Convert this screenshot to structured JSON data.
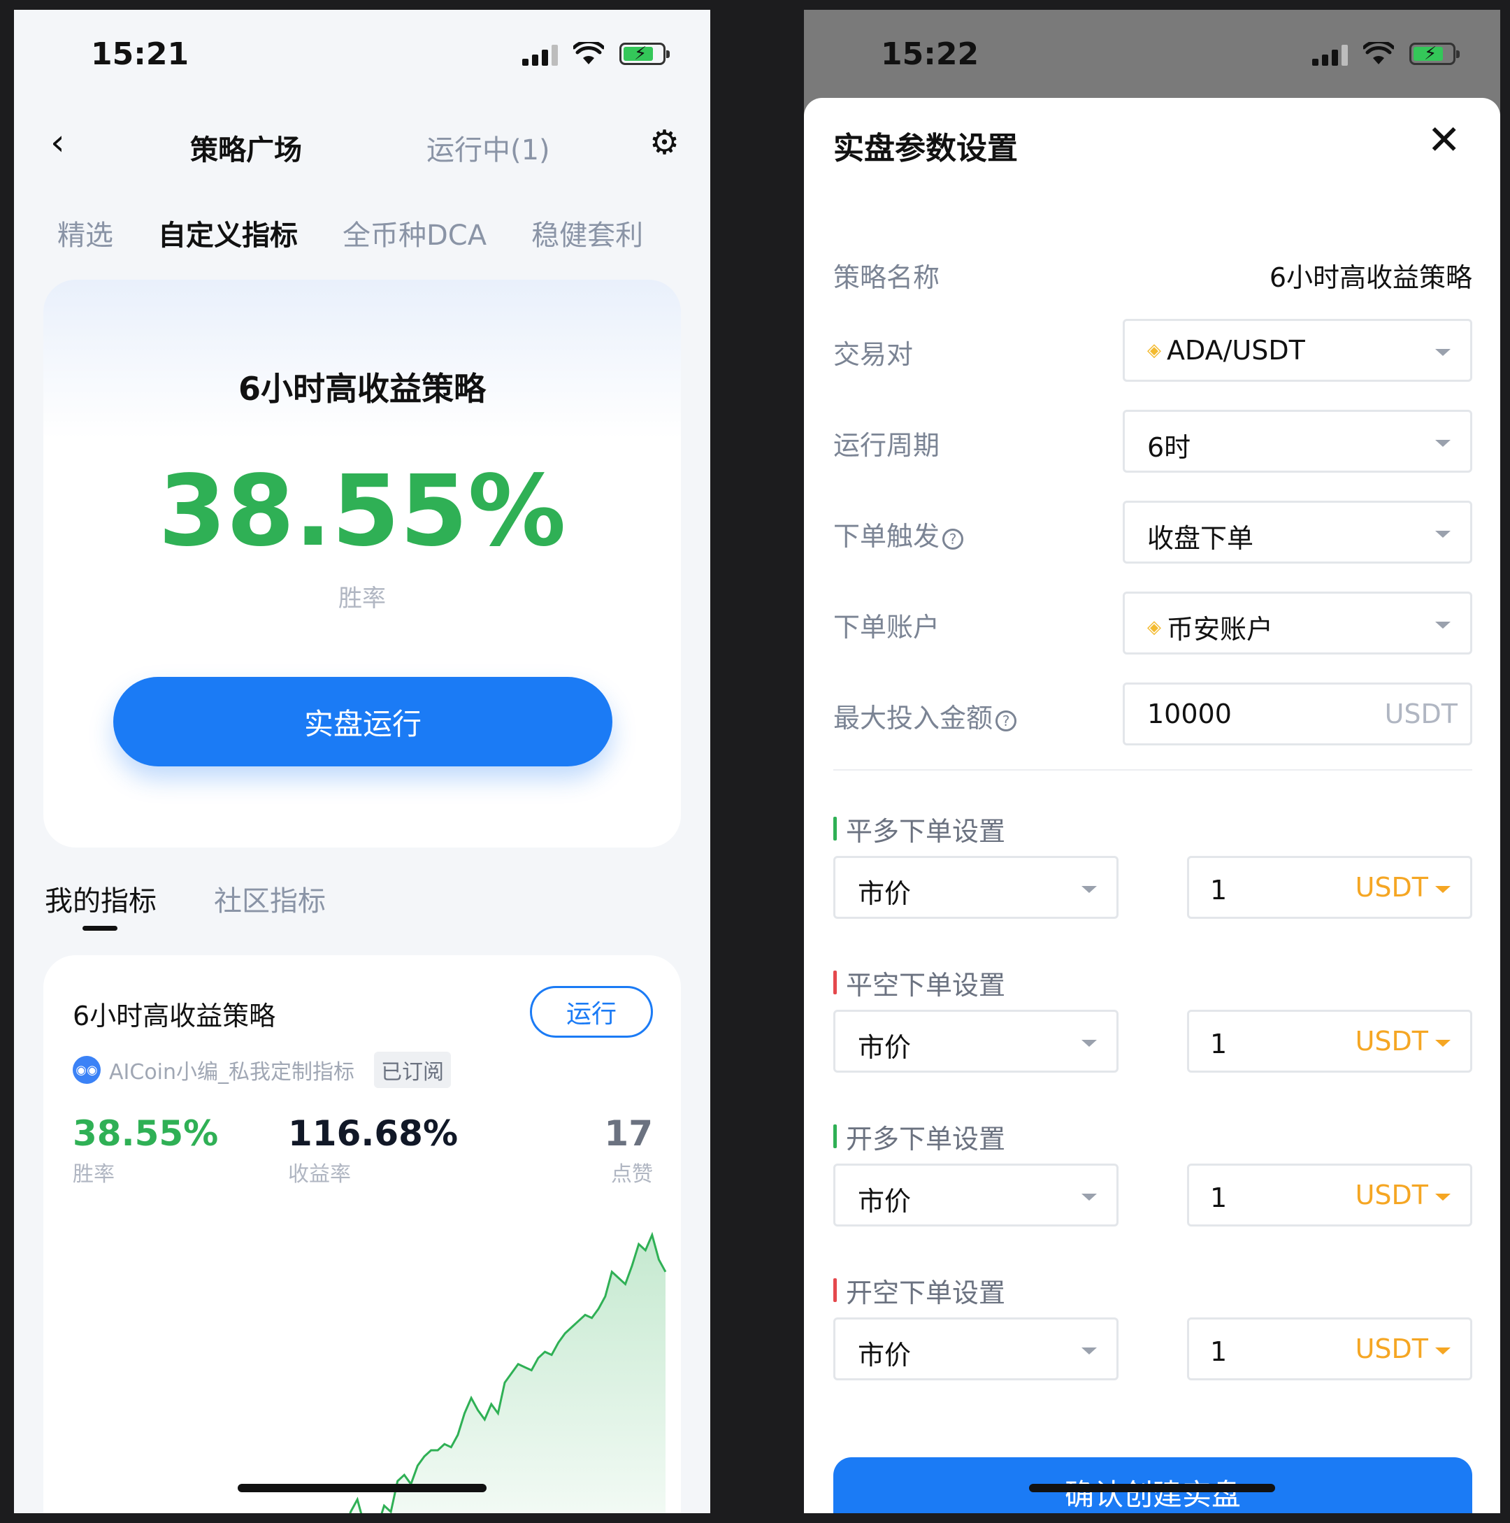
{
  "left": {
    "status": {
      "time": "15:21"
    },
    "nav": {
      "title": "策略广场",
      "running": "运行中(1)"
    },
    "top_tabs": [
      "精选",
      "自定义指标",
      "全币种DCA",
      "稳健套利"
    ],
    "hero": {
      "title": "6小时高收益策略",
      "value": "38.55%",
      "label": "胜率",
      "button": "实盘运行"
    },
    "sub_tabs": [
      "我的指标",
      "社区指标"
    ],
    "strategy_card": {
      "title": "6小时高收益策略",
      "run_button": "运行",
      "author": "AICoin小编_私我定制指标",
      "badge": "已订阅",
      "stats": [
        {
          "value": "38.55%",
          "label": "胜率",
          "color": "#2fb055"
        },
        {
          "value": "116.68%",
          "label": "收益率",
          "color": "#111827"
        },
        {
          "value": "17",
          "label": "点赞",
          "color": "#6b7280"
        }
      ]
    },
    "chart_data": {
      "type": "area",
      "values": [
        0.02,
        0.1,
        0.14,
        0.06,
        0.03,
        0.05,
        0.12,
        0.1,
        0.2,
        0.22,
        0.19,
        0.25,
        0.28,
        0.3,
        0.3,
        0.32,
        0.31,
        0.35,
        0.42,
        0.47,
        0.43,
        0.4,
        0.45,
        0.42,
        0.52,
        0.55,
        0.58,
        0.57,
        0.56,
        0.6,
        0.62,
        0.61,
        0.65,
        0.68,
        0.7,
        0.72,
        0.74,
        0.73,
        0.76,
        0.8,
        0.88,
        0.86,
        0.84,
        0.9,
        0.97,
        0.95,
        1.0,
        0.92,
        0.88
      ],
      "color": "#2fb055"
    }
  },
  "right": {
    "status": {
      "time": "15:22"
    },
    "sheet": {
      "title": "实盘参数设置",
      "fields": {
        "name": {
          "label": "策略名称",
          "value": "6小时高收益策略"
        },
        "pair": {
          "label": "交易对",
          "value": "ADA/USDT"
        },
        "period": {
          "label": "运行周期",
          "value": "6时"
        },
        "trigger": {
          "label": "下单触发",
          "value": "收盘下单"
        },
        "account": {
          "label": "下单账户",
          "value": "币安账户"
        },
        "max": {
          "label": "最大投入金额",
          "value": "10000",
          "unit": "USDT"
        }
      },
      "orders": [
        {
          "title": "平多下单设置",
          "type": "市价",
          "amount": "1",
          "unit": "USDT",
          "accent": "green"
        },
        {
          "title": "平空下单设置",
          "type": "市价",
          "amount": "1",
          "unit": "USDT",
          "accent": "red"
        },
        {
          "title": "开多下单设置",
          "type": "市价",
          "amount": "1",
          "unit": "USDT",
          "accent": "green"
        },
        {
          "title": "开空下单设置",
          "type": "市价",
          "amount": "1",
          "unit": "USDT",
          "accent": "red"
        }
      ],
      "confirm": "确认创建实盘"
    }
  }
}
